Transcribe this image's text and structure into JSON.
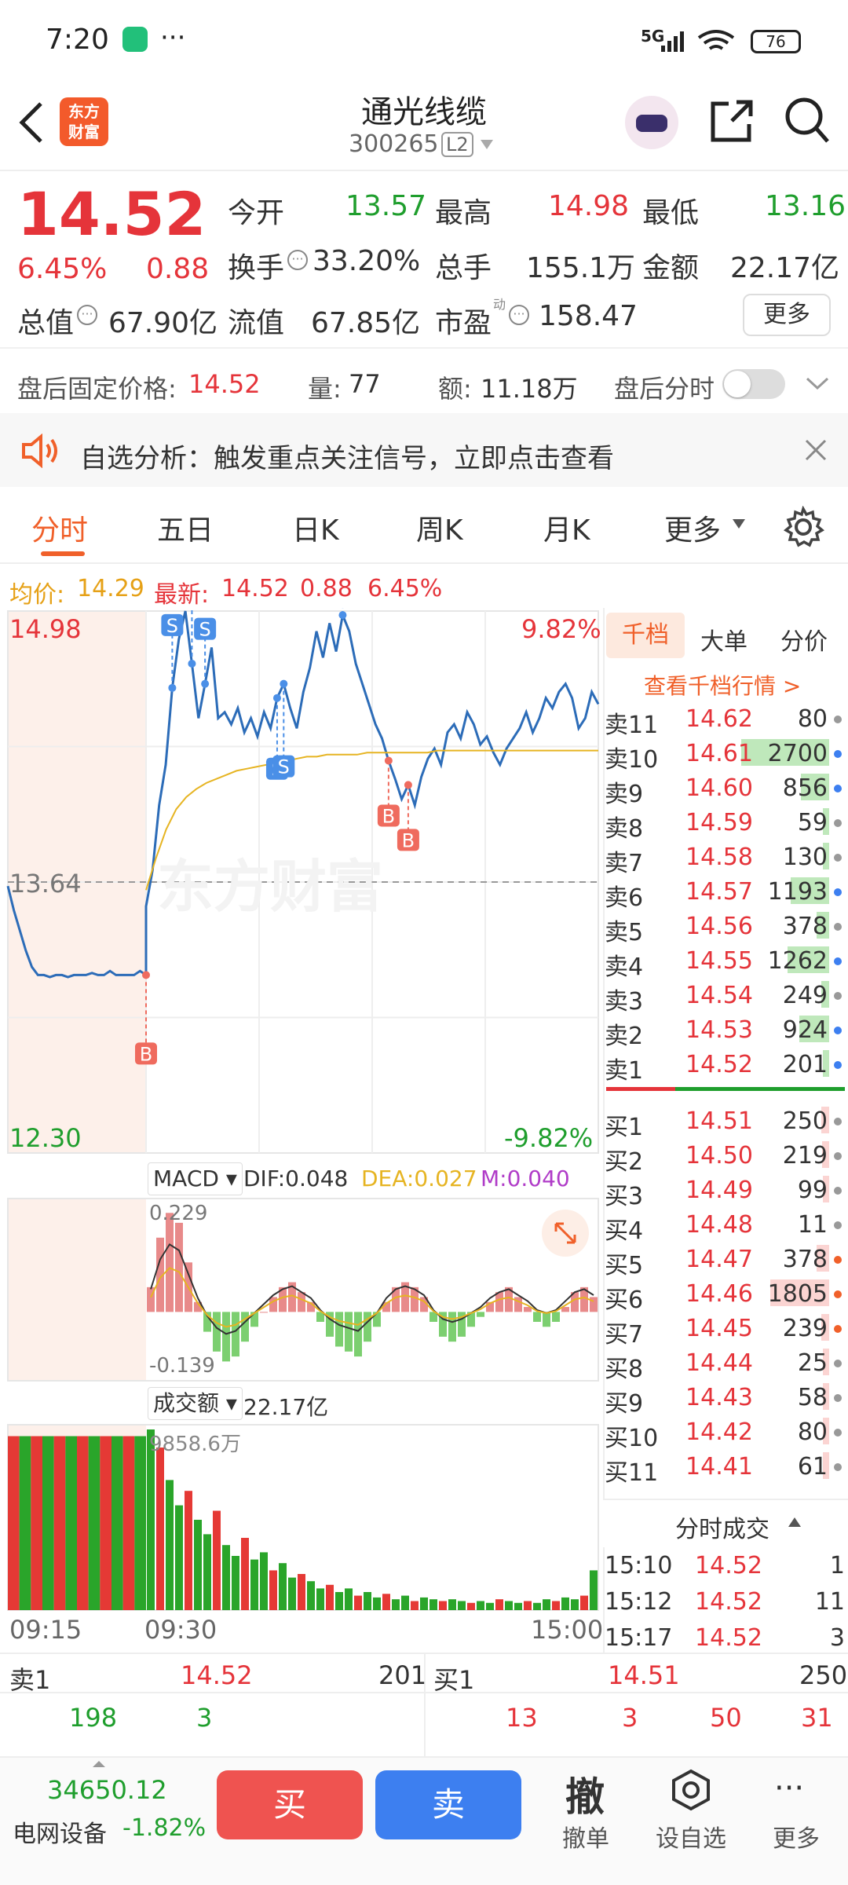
{
  "status_bar": {
    "time": "7:20",
    "network": "5G",
    "battery": "76"
  },
  "header": {
    "logo_line1": "东方",
    "logo_line2": "财富",
    "stock_name": "通光线缆",
    "stock_code": "300265",
    "level_badge": "L2"
  },
  "quote": {
    "price": "14.52",
    "change_pct": "6.45%",
    "change_amt": "0.88",
    "open_label": "今开",
    "open": "13.57",
    "high_label": "最高",
    "high": "14.98",
    "low_label": "最低",
    "low": "13.16",
    "turnover_label": "换手",
    "turnover": "33.20%",
    "volume_label": "总手",
    "volume": "155.1万",
    "amount_label": "金额",
    "amount": "22.17亿",
    "mktcap_label": "总值",
    "mktcap": "67.90亿",
    "float_label": "流值",
    "float": "67.85亿",
    "pe_label": "市盈",
    "pe_sup": "动",
    "pe": "158.47",
    "more_label": "更多"
  },
  "after_hours": {
    "price_label": "盘后固定价格:",
    "price": "14.52",
    "vol_label": "量:",
    "vol": "77",
    "amt_label": "额:",
    "amt": "11.18万",
    "switch_label": "盘后分时",
    "switch_on": false
  },
  "notice": {
    "text": "自选分析：触发重点关注信号，立即点击查看"
  },
  "tabs": [
    "分时",
    "五日",
    "日K",
    "周K",
    "月K",
    "更多"
  ],
  "active_tab": 0,
  "chart_info": {
    "avg_label": "均价:",
    "avg": "14.29",
    "last_label": "最新:",
    "last": "14.52",
    "chg": "0.88",
    "chg_pct": "6.45%"
  },
  "chart_data": {
    "type": "line",
    "y_max_label": "14.98",
    "y_ref_label": "13.64",
    "y_min_label": "12.30",
    "pct_max_label": "9.82%",
    "pct_min_label": "-9.82%",
    "ylim": [
      12.3,
      14.98
    ],
    "ref": 13.64,
    "x_start": "09:15",
    "x_open": "09:30",
    "x_end": "15:00",
    "price_series": [
      13.62,
      13.5,
      13.4,
      13.3,
      13.22,
      13.18,
      13.18,
      13.17,
      13.18,
      13.18,
      13.17,
      13.18,
      13.18,
      13.18,
      13.19,
      13.18,
      13.18,
      13.2,
      13.18,
      13.18,
      13.18,
      13.18,
      13.2,
      13.18,
      13.52,
      13.7,
      14.02,
      14.22,
      14.6,
      14.84,
      14.98,
      14.72,
      14.45,
      14.62,
      14.8,
      14.45,
      14.48,
      14.42,
      14.5,
      14.38,
      14.45,
      14.36,
      14.48,
      14.4,
      14.55,
      14.62,
      14.5,
      14.4,
      14.58,
      14.7,
      14.88,
      14.75,
      14.92,
      14.78,
      14.96,
      14.88,
      14.72,
      14.62,
      14.52,
      14.42,
      14.35,
      14.24,
      14.15,
      14.05,
      14.12,
      14.02,
      14.16,
      14.25,
      14.3,
      14.22,
      14.38,
      14.42,
      14.35,
      14.48,
      14.42,
      14.32,
      14.36,
      14.28,
      14.22,
      14.3,
      14.35,
      14.4,
      14.48,
      14.38,
      14.45,
      14.55,
      14.5,
      14.58,
      14.62,
      14.55,
      14.4,
      14.45,
      14.58,
      14.52
    ],
    "avg_series": [
      13.6,
      13.76,
      13.9,
      14.0,
      14.06,
      14.1,
      14.13,
      14.15,
      14.17,
      14.19,
      14.2,
      14.21,
      14.22,
      14.23,
      14.24,
      14.25,
      14.26,
      14.26,
      14.27,
      14.27,
      14.27,
      14.27,
      14.28,
      14.28,
      14.28,
      14.28,
      14.28,
      14.28,
      14.28,
      14.29,
      14.29,
      14.29,
      14.29,
      14.29,
      14.29,
      14.29,
      14.29,
      14.29,
      14.29,
      14.29,
      14.29,
      14.29,
      14.29,
      14.29,
      14.29,
      14.29
    ],
    "markers": [
      {
        "label": "S",
        "idx": 31
      },
      {
        "label": "S",
        "idx": 28
      },
      {
        "label": "S",
        "idx": 33
      },
      {
        "label": "S",
        "idx": 54
      },
      {
        "label": "S",
        "idx": 44
      },
      {
        "label": "S",
        "idx": 45
      },
      {
        "label": "B",
        "idx": 23
      },
      {
        "label": "B",
        "idx": 61
      },
      {
        "label": "B",
        "idx": 64
      }
    ],
    "watermark": "东方财富"
  },
  "macd": {
    "name": "MACD",
    "dif": "DIF:0.048",
    "dea": "DEA:0.027",
    "m": "M:0.040",
    "top_label": "0.229",
    "bottom_label": "-0.139",
    "colors": {
      "dif": "#333333",
      "dea": "#e6b422",
      "m": "#b03cc8"
    },
    "bars": [
      0.05,
      0.15,
      0.2,
      0.18,
      0.1,
      0.02,
      -0.04,
      -0.08,
      -0.1,
      -0.09,
      -0.06,
      -0.03,
      0,
      0.03,
      0.05,
      0.06,
      0.04,
      0.02,
      -0.02,
      -0.05,
      -0.07,
      -0.08,
      -0.09,
      -0.06,
      -0.03,
      0.02,
      0.05,
      0.06,
      0.05,
      0.03,
      -0.02,
      -0.05,
      -0.06,
      -0.05,
      -0.03,
      -0.01,
      0.02,
      0.04,
      0.05,
      0.03,
      0.01,
      -0.02,
      -0.03,
      -0.02,
      0.01,
      0.04,
      0.05,
      0.03
    ]
  },
  "volume": {
    "name": "成交额",
    "total": "22.17亿",
    "max_label": "9858.6万",
    "bars_pre": [
      0.98,
      0.98,
      0.98,
      0.98,
      0.98,
      0.98,
      0.98,
      0.98,
      0.98,
      0.98,
      0.98,
      0.98
    ],
    "bars": [
      1.0,
      0.9,
      0.72,
      0.58,
      0.66,
      0.5,
      0.42,
      0.55,
      0.36,
      0.3,
      0.4,
      0.28,
      0.32,
      0.22,
      0.26,
      0.18,
      0.2,
      0.16,
      0.12,
      0.14,
      0.1,
      0.12,
      0.08,
      0.1,
      0.07,
      0.09,
      0.06,
      0.08,
      0.05,
      0.07,
      0.06,
      0.05,
      0.06,
      0.05,
      0.04,
      0.05,
      0.04,
      0.06,
      0.05,
      0.04,
      0.05,
      0.04,
      0.06,
      0.05,
      0.07,
      0.06,
      0.08,
      0.22
    ]
  },
  "order_book": {
    "tabs": [
      "千档",
      "大单",
      "分价"
    ],
    "link": "查看千档行情 >",
    "asks": [
      {
        "label": "卖11",
        "price": "14.62",
        "vol": "80",
        "bar": 0.0,
        "dot": "gray"
      },
      {
        "label": "卖10",
        "price": "14.61",
        "vol": "2700",
        "bar": 1.0,
        "dot": "blue"
      },
      {
        "label": "卖9",
        "price": "14.60",
        "vol": "856",
        "bar": 0.32,
        "dot": "blue"
      },
      {
        "label": "卖8",
        "price": "14.59",
        "vol": "59",
        "bar": 0.02,
        "dot": "gray"
      },
      {
        "label": "卖7",
        "price": "14.58",
        "vol": "130",
        "bar": 0.05,
        "dot": "gray"
      },
      {
        "label": "卖6",
        "price": "14.57",
        "vol": "1193",
        "bar": 0.44,
        "dot": "blue"
      },
      {
        "label": "卖5",
        "price": "14.56",
        "vol": "378",
        "bar": 0.14,
        "dot": "gray"
      },
      {
        "label": "卖4",
        "price": "14.55",
        "vol": "1262",
        "bar": 0.47,
        "dot": "blue"
      },
      {
        "label": "卖3",
        "price": "14.54",
        "vol": "249",
        "bar": 0.09,
        "dot": "gray"
      },
      {
        "label": "卖2",
        "price": "14.53",
        "vol": "924",
        "bar": 0.34,
        "dot": "blue"
      },
      {
        "label": "卖1",
        "price": "14.52",
        "vol": "201",
        "bar": 0.07,
        "dot": "blue"
      }
    ],
    "bids": [
      {
        "label": "买1",
        "price": "14.51",
        "vol": "250",
        "bar": 0.09,
        "dot": "gray"
      },
      {
        "label": "买2",
        "price": "14.50",
        "vol": "219",
        "bar": 0.08,
        "dot": "gray"
      },
      {
        "label": "买3",
        "price": "14.49",
        "vol": "99",
        "bar": 0.04,
        "dot": "gray"
      },
      {
        "label": "买4",
        "price": "14.48",
        "vol": "11",
        "bar": 0.0,
        "dot": "gray"
      },
      {
        "label": "买5",
        "price": "14.47",
        "vol": "378",
        "bar": 0.14,
        "dot": "orange"
      },
      {
        "label": "买6",
        "price": "14.46",
        "vol": "1805",
        "bar": 0.67,
        "dot": "orange"
      },
      {
        "label": "买7",
        "price": "14.45",
        "vol": "239",
        "bar": 0.09,
        "dot": "orange"
      },
      {
        "label": "买8",
        "price": "14.44",
        "vol": "25",
        "bar": 0.01,
        "dot": "gray"
      },
      {
        "label": "买9",
        "price": "14.43",
        "vol": "58",
        "bar": 0.02,
        "dot": "gray"
      },
      {
        "label": "买10",
        "price": "14.42",
        "vol": "80",
        "bar": 0.03,
        "dot": "gray"
      },
      {
        "label": "买11",
        "price": "14.41",
        "vol": "61",
        "bar": 0.02,
        "dot": "gray"
      }
    ],
    "trades_title": "分时成交",
    "trades": [
      {
        "time": "15:10",
        "price": "14.52",
        "vol": "1"
      },
      {
        "time": "15:12",
        "price": "14.52",
        "vol": "11"
      },
      {
        "time": "15:17",
        "price": "14.52",
        "vol": "3"
      }
    ]
  },
  "level_summary": {
    "ask_label": "卖1",
    "ask_price": "14.52",
    "ask_vol": "201",
    "bid_label": "买1",
    "bid_price": "14.51",
    "bid_vol": "250",
    "ask_queue": [
      "198",
      "3"
    ],
    "bid_queue": [
      "13",
      "3",
      "50",
      "31"
    ]
  },
  "bottom_bar": {
    "index_value": "34650.12",
    "index_name": "电网设备",
    "index_change": "-1.82%",
    "buy_label": "买",
    "sell_label": "卖",
    "cancel_icon_text": "撤",
    "cancel_label": "撤单",
    "watch_label": "设自选",
    "more_label": "更多"
  },
  "colors": {
    "up": "#e5343a",
    "down": "#1f9e2d",
    "accent": "#f0602a",
    "buy_btn": "#ef5350",
    "sell_btn": "#3d7ff0",
    "line": "#2c6cb8"
  }
}
